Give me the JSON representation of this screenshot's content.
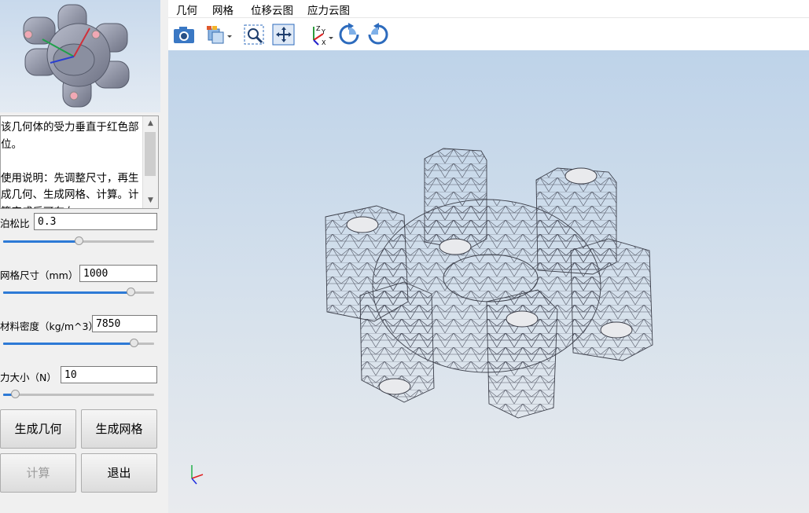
{
  "menu": [
    "几何",
    "网格",
    "位移云图",
    "应力云图"
  ],
  "toolbar": {
    "icons": [
      "camera-icon",
      "view-cube-icon",
      "zoom-window-icon",
      "fit-all-icon",
      "axes-orient-icon",
      "rotate-cw-icon",
      "rotate-ccw-icon"
    ]
  },
  "description": {
    "text": "该几何体的受力垂直于红色部位。\n\n使用说明：先调整尺寸，再生成几何、生成网格、计算。计算完成后可在右"
  },
  "params": [
    {
      "label": "泊松比",
      "value": "0.3",
      "slider": 0.5
    },
    {
      "label": "网格尺寸（mm）",
      "value": "1000",
      "slider": 0.85
    },
    {
      "label": "材料密度（kg/m^3）",
      "value": "7850",
      "slider": 0.87
    },
    {
      "label": "力大小（N）",
      "value": "10",
      "slider": 0.08
    }
  ],
  "buttons": {
    "gen_geometry": "生成几何",
    "gen_mesh": "生成网格",
    "compute": "计算",
    "exit": "退出"
  },
  "colors": {
    "slider_fill": "#2d7ad6",
    "viewport_top": "#bed3e9",
    "viewport_bottom": "#e9ebee"
  }
}
